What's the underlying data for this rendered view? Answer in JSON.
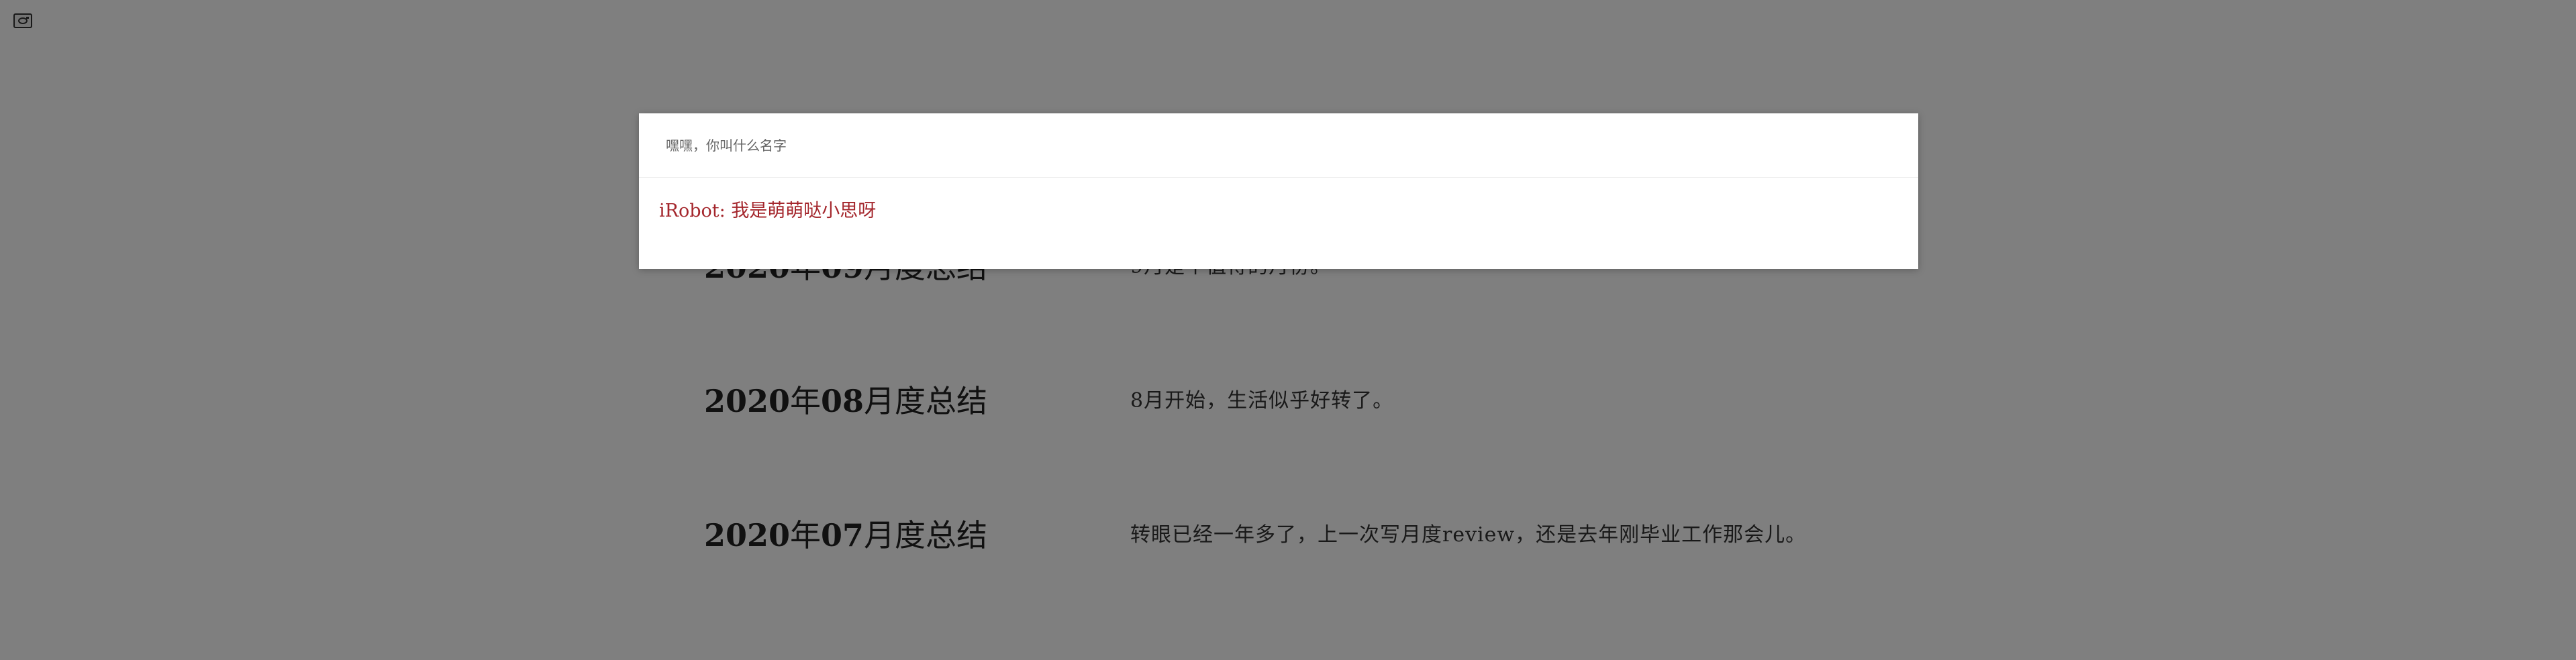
{
  "corner": {
    "icon": "camera-icon"
  },
  "posts": [
    {
      "title_year": "2020",
      "title_nian": "年",
      "title_month": "09",
      "title_suffix": "月度总结",
      "excerpt": "9月是个值得的月份。"
    },
    {
      "title_year": "2020",
      "title_nian": "年",
      "title_month": "08",
      "title_suffix": "月度总结",
      "excerpt": "8月开始，生活似乎好转了。"
    },
    {
      "title_year": "2020",
      "title_nian": "年",
      "title_month": "07",
      "title_suffix": "月度总结",
      "excerpt": "转眼已经一年多了，上一次写月度review，还是去年刚毕业工作那会儿。"
    }
  ],
  "chat": {
    "input_placeholder": "嘿嘿，你叫什么名字",
    "input_value": "",
    "reply_speaker": "iRobot:",
    "reply_text": "我是萌萌哒小思呀"
  },
  "colors": {
    "overlay": "rgba(0,0,0,0.5)",
    "reply": "#a4262c"
  }
}
